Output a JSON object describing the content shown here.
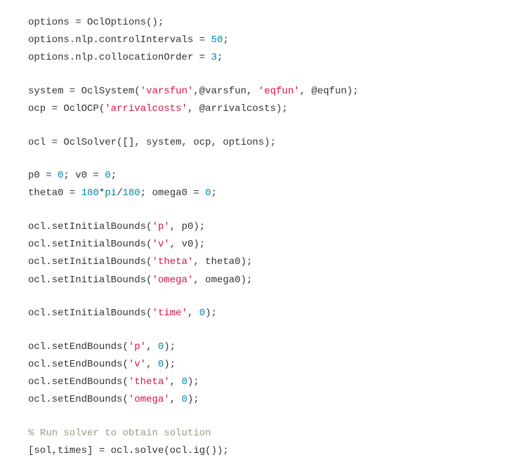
{
  "code": {
    "lines": [
      {
        "type": "code",
        "tokens": [
          {
            "t": "options = OclOptions();",
            "c": "default"
          }
        ]
      },
      {
        "type": "code",
        "tokens": [
          {
            "t": "options.nlp.controlIntervals = ",
            "c": "default"
          },
          {
            "t": "50",
            "c": "number"
          },
          {
            "t": ";",
            "c": "default"
          }
        ]
      },
      {
        "type": "code",
        "tokens": [
          {
            "t": "options.nlp.collocationOrder = ",
            "c": "default"
          },
          {
            "t": "3",
            "c": "number"
          },
          {
            "t": ";",
            "c": "default"
          }
        ]
      },
      {
        "type": "blank"
      },
      {
        "type": "code",
        "tokens": [
          {
            "t": "system = OclSystem(",
            "c": "default"
          },
          {
            "t": "'varsfun'",
            "c": "string"
          },
          {
            "t": ",@varsfun, ",
            "c": "default"
          },
          {
            "t": "'eqfun'",
            "c": "string"
          },
          {
            "t": ", @eqfun);",
            "c": "default"
          }
        ]
      },
      {
        "type": "code",
        "tokens": [
          {
            "t": "ocp = OclOCP(",
            "c": "default"
          },
          {
            "t": "'arrivalcosts'",
            "c": "string"
          },
          {
            "t": ", @arrivalcosts);",
            "c": "default"
          }
        ]
      },
      {
        "type": "blank"
      },
      {
        "type": "code",
        "tokens": [
          {
            "t": "ocl = OclSolver([], system, ocp, options);",
            "c": "default"
          }
        ]
      },
      {
        "type": "blank"
      },
      {
        "type": "code",
        "tokens": [
          {
            "t": "p0 = ",
            "c": "default"
          },
          {
            "t": "0",
            "c": "number"
          },
          {
            "t": "; v0 = ",
            "c": "default"
          },
          {
            "t": "0",
            "c": "number"
          },
          {
            "t": ";",
            "c": "default"
          }
        ]
      },
      {
        "type": "code",
        "tokens": [
          {
            "t": "theta0 = ",
            "c": "default"
          },
          {
            "t": "180",
            "c": "number"
          },
          {
            "t": "*",
            "c": "default"
          },
          {
            "t": "pi",
            "c": "keyword"
          },
          {
            "t": "/",
            "c": "default"
          },
          {
            "t": "180",
            "c": "number"
          },
          {
            "t": "; omega0 = ",
            "c": "default"
          },
          {
            "t": "0",
            "c": "number"
          },
          {
            "t": ";",
            "c": "default"
          }
        ]
      },
      {
        "type": "blank"
      },
      {
        "type": "code",
        "tokens": [
          {
            "t": "ocl.setInitialBounds(",
            "c": "default"
          },
          {
            "t": "'p'",
            "c": "string"
          },
          {
            "t": ", p0);",
            "c": "default"
          }
        ]
      },
      {
        "type": "code",
        "tokens": [
          {
            "t": "ocl.setInitialBounds(",
            "c": "default"
          },
          {
            "t": "'v'",
            "c": "string"
          },
          {
            "t": ", v0);",
            "c": "default"
          }
        ]
      },
      {
        "type": "code",
        "tokens": [
          {
            "t": "ocl.setInitialBounds(",
            "c": "default"
          },
          {
            "t": "'theta'",
            "c": "string"
          },
          {
            "t": ", theta0);",
            "c": "default"
          }
        ]
      },
      {
        "type": "code",
        "tokens": [
          {
            "t": "ocl.setInitialBounds(",
            "c": "default"
          },
          {
            "t": "'omega'",
            "c": "string"
          },
          {
            "t": ", omega0);",
            "c": "default"
          }
        ]
      },
      {
        "type": "blank"
      },
      {
        "type": "code",
        "tokens": [
          {
            "t": "ocl.setInitialBounds(",
            "c": "default"
          },
          {
            "t": "'time'",
            "c": "string"
          },
          {
            "t": ", ",
            "c": "default"
          },
          {
            "t": "0",
            "c": "number"
          },
          {
            "t": ");",
            "c": "default"
          }
        ]
      },
      {
        "type": "blank"
      },
      {
        "type": "code",
        "tokens": [
          {
            "t": "ocl.setEndBounds(",
            "c": "default"
          },
          {
            "t": "'p'",
            "c": "string"
          },
          {
            "t": ", ",
            "c": "default"
          },
          {
            "t": "0",
            "c": "number"
          },
          {
            "t": ");",
            "c": "default"
          }
        ]
      },
      {
        "type": "code",
        "tokens": [
          {
            "t": "ocl.setEndBounds(",
            "c": "default"
          },
          {
            "t": "'v'",
            "c": "string"
          },
          {
            "t": ", ",
            "c": "default"
          },
          {
            "t": "0",
            "c": "number"
          },
          {
            "t": ");",
            "c": "default"
          }
        ]
      },
      {
        "type": "code",
        "tokens": [
          {
            "t": "ocl.setEndBounds(",
            "c": "default"
          },
          {
            "t": "'theta'",
            "c": "string"
          },
          {
            "t": ", ",
            "c": "default"
          },
          {
            "t": "0",
            "c": "number"
          },
          {
            "t": ");",
            "c": "default"
          }
        ]
      },
      {
        "type": "code",
        "tokens": [
          {
            "t": "ocl.setEndBounds(",
            "c": "default"
          },
          {
            "t": "'omega'",
            "c": "string"
          },
          {
            "t": ", ",
            "c": "default"
          },
          {
            "t": "0",
            "c": "number"
          },
          {
            "t": ");",
            "c": "default"
          }
        ]
      },
      {
        "type": "blank"
      },
      {
        "type": "code",
        "tokens": [
          {
            "t": "% Run solver to obtain solution",
            "c": "comment"
          }
        ]
      },
      {
        "type": "code",
        "tokens": [
          {
            "t": "[sol,times] = ocl.solve(ocl.ig());",
            "c": "default"
          }
        ]
      }
    ]
  }
}
